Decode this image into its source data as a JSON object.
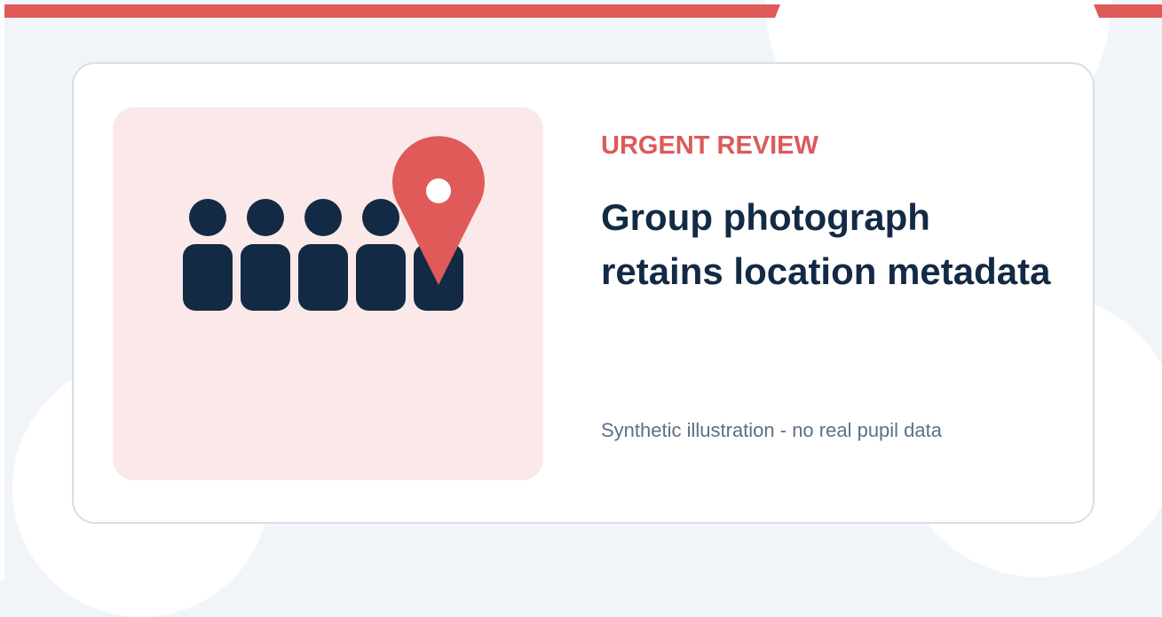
{
  "banner": {
    "label": "URGENT REVIEW",
    "title": "Group photograph retains location metadata",
    "caption": "Synthetic illustration - no real pupil data"
  },
  "illustration": {
    "people_count": 5,
    "icons": [
      "people-group-icon",
      "location-pin-icon"
    ]
  },
  "colors": {
    "accent": "#e05a5a",
    "label": "#dc5a5a",
    "heading": "#132a45",
    "muted": "#5a7188",
    "illustration_bg": "#fbe9ea",
    "page_bg": "#f1f5f9",
    "card_border": "#d7dee8"
  }
}
